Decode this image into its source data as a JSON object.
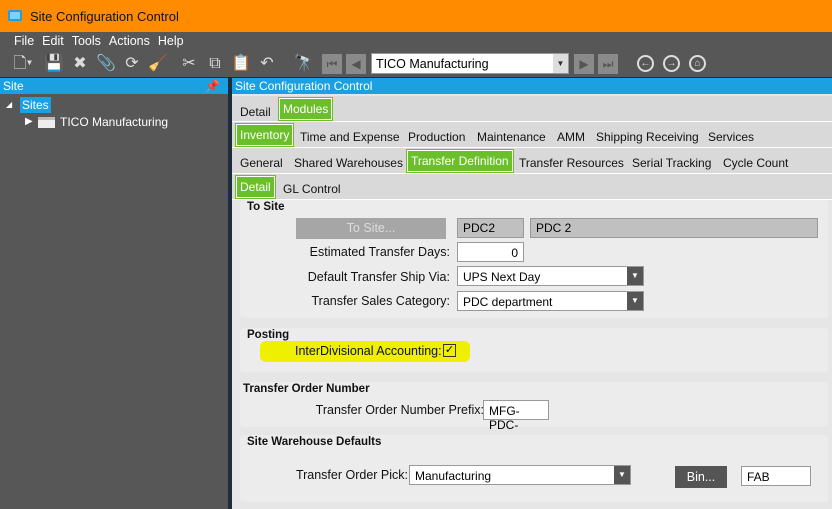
{
  "window": {
    "title": "Site Configuration Control"
  },
  "menu": [
    "File",
    "Edit",
    "Tools",
    "Actions",
    "Help"
  ],
  "toolbar": {
    "site_combo": "TICO Manufacturing"
  },
  "left_panel": {
    "title": "Site",
    "tree": {
      "root": "Sites",
      "child": "TICO Manufacturing"
    }
  },
  "right_panel": {
    "title": "Site Configuration Control"
  },
  "tabs": {
    "row1": [
      {
        "label": "Detail",
        "active": false
      },
      {
        "label": "Modules",
        "active": true
      }
    ],
    "row2": [
      {
        "label": "Inventory",
        "active": true
      },
      {
        "label": "Time and Expense"
      },
      {
        "label": "Production"
      },
      {
        "label": "Maintenance"
      },
      {
        "label": "AMM"
      },
      {
        "label": "Shipping Receiving"
      },
      {
        "label": "Services"
      }
    ],
    "row3": [
      {
        "label": "General"
      },
      {
        "label": "Shared Warehouses"
      },
      {
        "label": "Transfer Definition",
        "active": true
      },
      {
        "label": "Transfer Resources"
      },
      {
        "label": "Serial Tracking"
      },
      {
        "label": "Cycle Count"
      }
    ],
    "row4": [
      {
        "label": "Detail",
        "active": true
      },
      {
        "label": "GL Control"
      }
    ]
  },
  "to_site": {
    "title": "To Site",
    "button": "To Site...",
    "site_id": "PDC2",
    "site_name": "PDC 2",
    "est_days_label": "Estimated Transfer Days:",
    "est_days": "0",
    "ship_via_label": "Default Transfer Ship Via:",
    "ship_via": "UPS Next Day",
    "sales_cat_label": "Transfer Sales Category:",
    "sales_cat": "PDC department"
  },
  "posting": {
    "title": "Posting",
    "ida_label": "InterDivisional Accounting:",
    "ida_checked": true,
    "highlight": "#eef000"
  },
  "transfer_order_number": {
    "title": "Transfer Order Number",
    "prefix_label": "Transfer Order Number Prefix:",
    "prefix": "MFG-PDC-"
  },
  "warehouse_defaults": {
    "title": "Site Warehouse Defaults",
    "pick_label": "Transfer Order Pick:",
    "pick": "Manufacturing",
    "bin_button": "Bin...",
    "bin": "FAB"
  },
  "colors": {
    "title_bar": "#FF8C00",
    "header": "#1ba1e2",
    "active_tab": "#6abf2a"
  }
}
